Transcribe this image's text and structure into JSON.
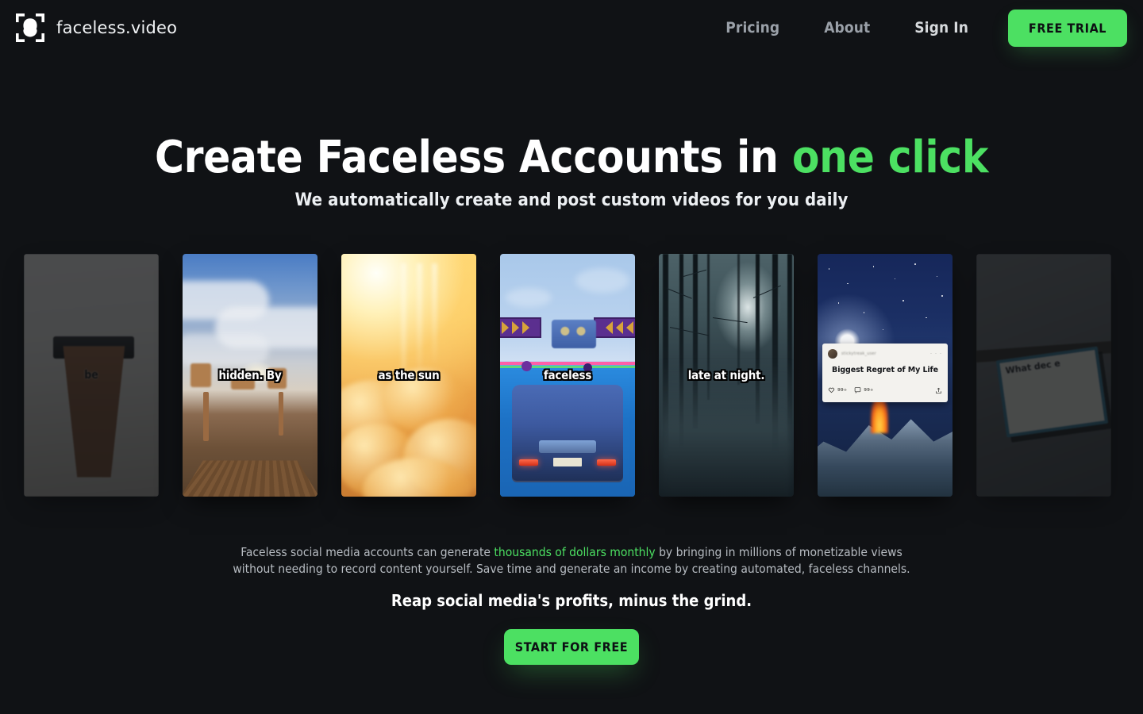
{
  "brand": {
    "name": "faceless.video",
    "logo_icon": "face-scan-icon"
  },
  "nav": {
    "links": [
      {
        "label": "Pricing",
        "name": "pricing"
      },
      {
        "label": "About",
        "name": "about"
      },
      {
        "label": "Sign In",
        "name": "sign-in"
      }
    ],
    "cta_label": "FREE TRIAL"
  },
  "hero": {
    "headline_lead": "Create Faceless Accounts in ",
    "headline_accent": "one click",
    "subhead": "We automatically create and post custom videos for you daily"
  },
  "carousel": {
    "cards": [
      {
        "caption": "be",
        "name": "carousel-card-product-left",
        "edge": true
      },
      {
        "caption": "hidden. By",
        "name": "carousel-card-minecraft-day",
        "edge": false
      },
      {
        "caption": "as the sun",
        "name": "carousel-card-golden-clouds",
        "edge": false
      },
      {
        "caption": "faceless",
        "name": "carousel-card-blue-car",
        "edge": false
      },
      {
        "caption": "late at night.",
        "name": "carousel-card-foggy-forest",
        "edge": false
      },
      {
        "caption": "",
        "name": "carousel-card-reddit-night",
        "edge": false
      },
      {
        "caption": "What\ndec\ne",
        "name": "carousel-card-note-right",
        "edge": true
      }
    ],
    "reddit_card": {
      "username": "",
      "title": "Biggest Regret of My Life",
      "likes": "99+",
      "comments": "99+",
      "menu": "· · ·"
    }
  },
  "body": {
    "paragraph_part1": "Faceless social media accounts can generate ",
    "paragraph_highlight": "thousands of dollars monthly",
    "paragraph_part2": " by bringing in millions of monetizable views without needing to record content yourself. Save time and generate an income by creating automated, faceless channels.",
    "tagline": "Reap social media's profits, minus the grind.",
    "cta_label": "START FOR FREE"
  },
  "colors": {
    "background": "#101215",
    "accent_green": "#4ce062",
    "text_primary": "#ffffff",
    "text_muted": "#b7bcc2",
    "nav_link": "#9aa0a8"
  }
}
